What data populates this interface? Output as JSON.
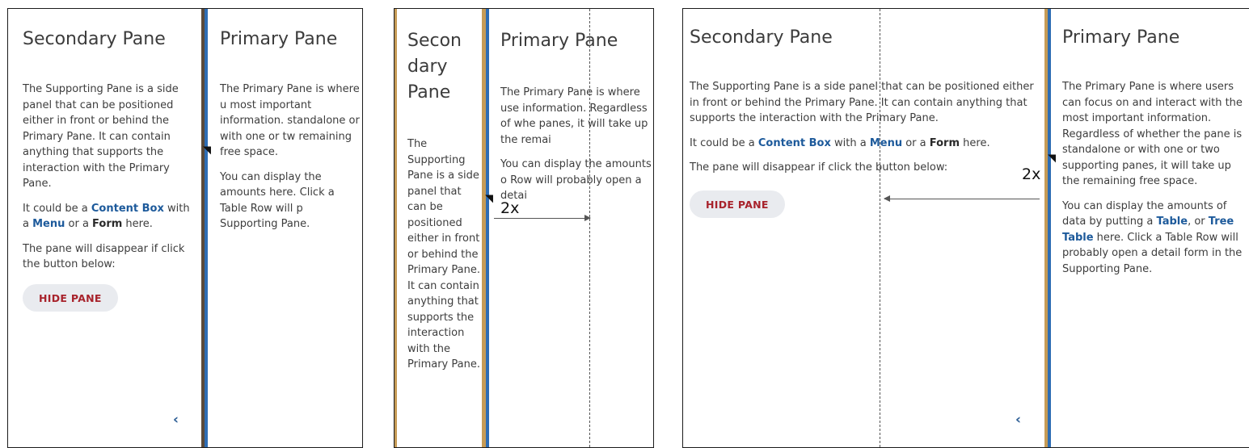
{
  "panel1": {
    "secondary_title": "Secondary Pane",
    "secondary_para1": "The Supporting Pane is a side panel that can be positioned either in front or behind the Primary Pane. It can contain anything that supports the interaction with the Primary Pane.",
    "could_prefix": "It could be a ",
    "content_box": "Content Box",
    "with_a": " with a ",
    "menu": "Menu",
    "or_a": " or a ",
    "form": "Form",
    "here": " here.",
    "disappear": "The pane will disappear if click the button below:",
    "hide_button": "HIDE PANE",
    "collapse_chevron": "‹",
    "primary_title": "Primary Pane",
    "primary_para1": "The Primary Pane is where u most important information. standalone or with one or tw remaining free space.",
    "primary_para2": "You can display the amounts here. Click a Table Row will p Supporting Pane."
  },
  "panel2": {
    "secondary_title": "Secon dary Pane",
    "secondary_para1": "The Supporting Pane is a side panel that can be positioned either in front or behind the Primary Pane. It can contain anything that supports the interaction with the Primary Pane.",
    "primary_title": "Primary Pane",
    "primary_para1": "The Primary Pane is where use information. Regardless of whe panes, it will take up the remai",
    "primary_para2": "You can display the amounts o Row will probably open a detai",
    "scale_label": "2x"
  },
  "panel3": {
    "secondary_title": "Secondary Pane",
    "secondary_para1": "The Supporting Pane is a side panel that can be positioned either in front or behind the Primary Pane. It can contain anything that supports the interaction with the Primary Pane.",
    "could_prefix": "It could be a ",
    "content_box": "Content Box",
    "with_a": " with a ",
    "menu": "Menu",
    "or_a": " or a ",
    "form": "Form",
    "here": " here.",
    "disappear": "The pane will disappear if click the button below:",
    "hide_button": "HIDE PANE",
    "collapse_chevron": "‹",
    "primary_title": "Primary Pane",
    "primary_para1": "The Primary Pane is where users can focus on and interact with the most important information. Regardless of whether the pane is standalone or with one or two supporting panes, it will take up the remaining free space.",
    "display_prefix": "You can display the amounts of data by putting a ",
    "table": "Table",
    "comma_or": ", or ",
    "tree_table": "Tree Table",
    "display_suffix": " here. Click a Table Row will probably open a detail form in the Supporting Pane.",
    "scale_label": "2x"
  },
  "colors": {
    "link": "#1d5a9b",
    "button_text": "#a8232c",
    "button_bg": "#e9ebef",
    "splitter_gold": "#c69b56",
    "splitter_blue": "#2e6db4"
  }
}
